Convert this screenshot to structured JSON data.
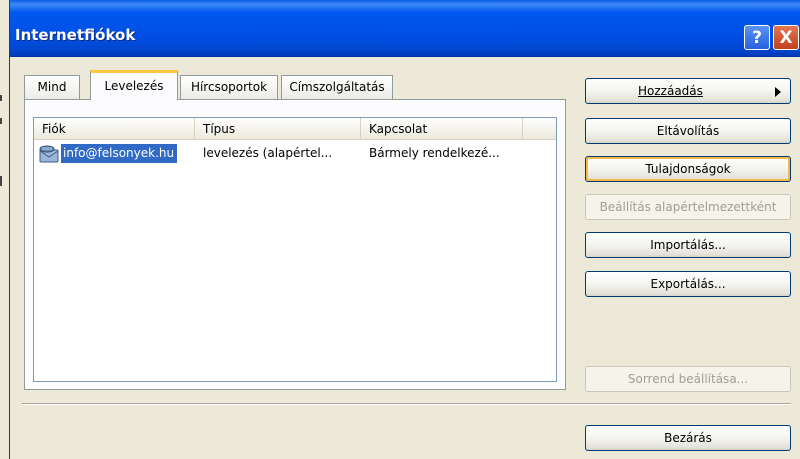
{
  "window": {
    "title": "Internetfiókok",
    "help_button": "?",
    "close_button": "X"
  },
  "tabs": [
    {
      "label": "Mind",
      "active": false
    },
    {
      "label": "Levelezés",
      "active": true
    },
    {
      "label": "Hírcsoportok",
      "active": false
    },
    {
      "label": "Címszolgáltatás",
      "active": false
    }
  ],
  "list": {
    "columns": [
      "Fiók",
      "Típus",
      "Kapcsolat"
    ],
    "rows": [
      {
        "account": "info@felsonyek.hu",
        "type": "levelezés (alapértel...",
        "connection": "Bármely rendelkezé...",
        "selected": true,
        "icon": "mail-account-icon"
      }
    ]
  },
  "buttons": {
    "add": "Hozzáadás",
    "remove": "Eltávolítás",
    "properties": "Tulajdonságok",
    "set_default": "Beállítás alapértelmezettként",
    "import": "Importálás...",
    "export": "Exportálás...",
    "set_order": "Sorrend beállítása...",
    "close": "Bezárás"
  },
  "colors": {
    "titlebar": "#0050e6",
    "selection": "#316ac5",
    "active_tab_accent": "#ffc83c",
    "dialog_bg": "#ece9d8"
  }
}
